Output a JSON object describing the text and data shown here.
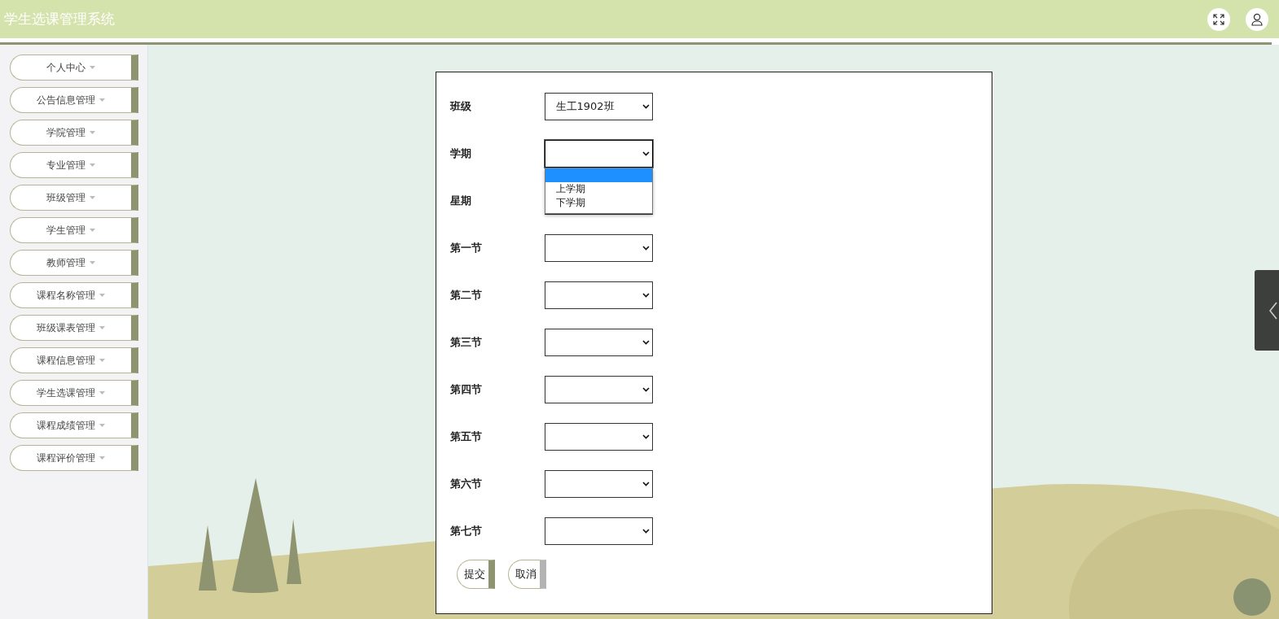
{
  "header": {
    "title": "学生选课管理系统"
  },
  "sidebar": {
    "items": [
      {
        "label": "个人中心"
      },
      {
        "label": "公告信息管理"
      },
      {
        "label": "学院管理"
      },
      {
        "label": "专业管理"
      },
      {
        "label": "班级管理"
      },
      {
        "label": "学生管理"
      },
      {
        "label": "教师管理"
      },
      {
        "label": "课程名称管理"
      },
      {
        "label": "班级课表管理"
      },
      {
        "label": "课程信息管理"
      },
      {
        "label": "学生选课管理"
      },
      {
        "label": "课程成绩管理"
      },
      {
        "label": "课程评价管理"
      }
    ]
  },
  "form": {
    "fields": [
      {
        "label": "班级",
        "value": "生工1902班",
        "expanded": false
      },
      {
        "label": "学期",
        "expanded": true,
        "options": [
          {
            "selected": true
          },
          {
            "label": "上学期",
            "selected": false
          },
          {
            "label": "下学期",
            "selected": false
          }
        ]
      },
      {
        "label": "星期",
        "expanded": false
      },
      {
        "label": "第一节",
        "expanded": false
      },
      {
        "label": "第二节",
        "expanded": false
      },
      {
        "label": "第三节",
        "expanded": false
      },
      {
        "label": "第四节",
        "expanded": false
      },
      {
        "label": "第五节",
        "expanded": false
      },
      {
        "label": "第六节",
        "expanded": false
      },
      {
        "label": "第七节",
        "expanded": false
      }
    ],
    "buttons": [
      {
        "label": "提交",
        "kind": "primary"
      },
      {
        "label": "取消",
        "kind": "secondary"
      }
    ]
  }
}
